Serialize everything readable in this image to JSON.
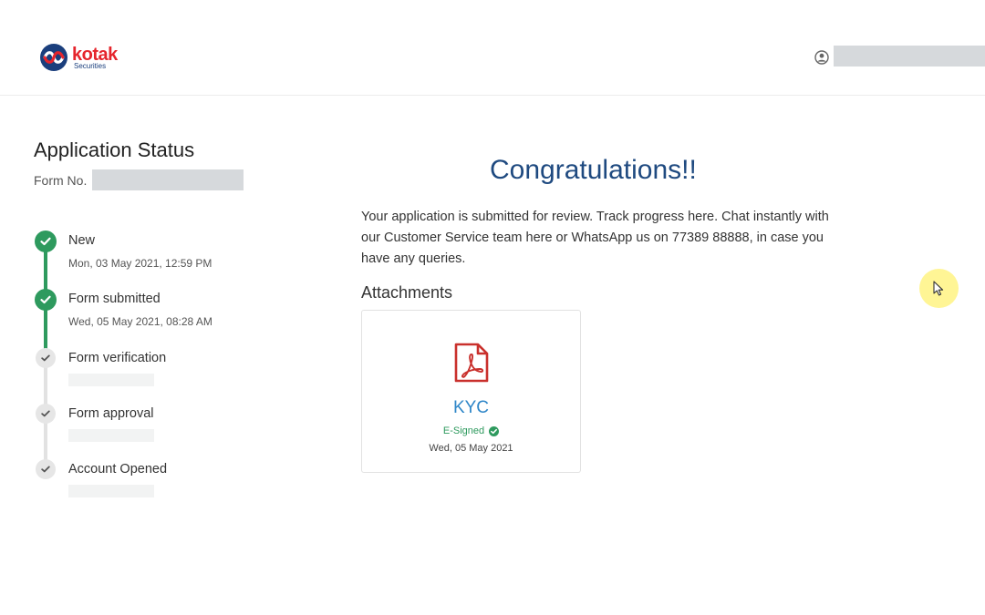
{
  "header": {
    "logo": {
      "brand": "kotak",
      "sub": "Securities",
      "icon": "kotak-logo-icon"
    },
    "user": {
      "icon": "user-icon",
      "name_redacted": true
    }
  },
  "status_panel": {
    "title": "Application Status",
    "form_no_label": "Form No.",
    "form_no_redacted": true,
    "steps": [
      {
        "label": "New",
        "date": "Mon, 03 May 2021, 12:59 PM",
        "state": "done"
      },
      {
        "label": "Form submitted",
        "date": "Wed, 05 May 2021, 08:28 AM",
        "state": "done"
      },
      {
        "label": "Form verification",
        "date": "",
        "state": "pending"
      },
      {
        "label": "Form approval",
        "date": "",
        "state": "pending"
      },
      {
        "label": "Account Opened",
        "date": "",
        "state": "pending"
      }
    ]
  },
  "main": {
    "heading": "Congratulations!!",
    "message": "Your application is submitted for review. Track progress here. Chat instantly with our Customer Service team here or WhatsApp us on 77389 88888, in case you have any queries.",
    "attachments_title": "Attachments",
    "attachments": [
      {
        "icon": "pdf-icon",
        "name": "KYC",
        "status": "E-Signed",
        "status_icon": "check-circle-icon",
        "date": "Wed, 05 May 2021"
      }
    ]
  },
  "colors": {
    "brand_red": "#e5252c",
    "brand_blue": "#1f4a80",
    "success_green": "#2e9a5e",
    "link_blue": "#2e86c8",
    "redaction_grey": "#d6d9dc"
  }
}
